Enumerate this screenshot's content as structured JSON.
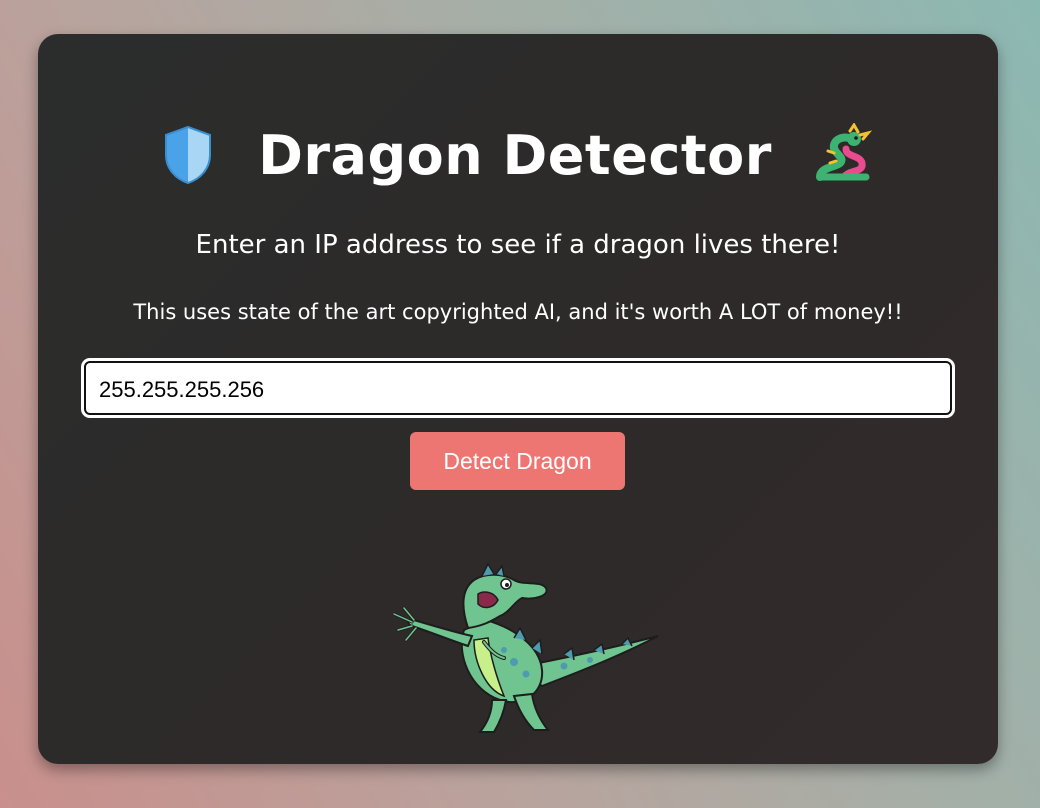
{
  "header": {
    "title": "Dragon Detector",
    "left_icon": "shield-icon",
    "right_icon": "dragon-emoji-icon"
  },
  "content": {
    "subtitle": "Enter an IP address to see if a dragon lives there!",
    "note": "This uses state of the art copyrighted AI, and it's worth A LOT of money!!"
  },
  "form": {
    "ip_value": "255.255.255.256",
    "detect_label": "Detect Dragon"
  },
  "illustration": {
    "name": "dancing-dragon-image"
  },
  "colors": {
    "card_background": "#2d2b2b",
    "button": "#ee7672",
    "text": "#ffffff",
    "dragon_green": "#6fc48f"
  }
}
